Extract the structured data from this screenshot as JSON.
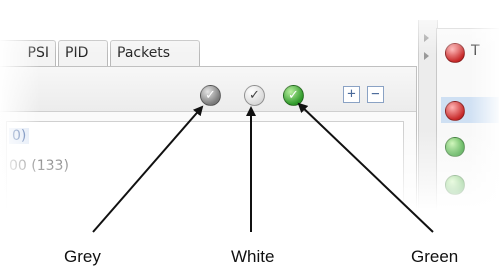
{
  "tabs": [
    {
      "label": "PSI"
    },
    {
      "label": "PID"
    },
    {
      "label": "Packets"
    }
  ],
  "list": {
    "rows": [
      "0)",
      "00 (133)"
    ]
  },
  "toolbar": {
    "status_icons": [
      {
        "icon": "grey-check-icon",
        "glyph": "✓"
      },
      {
        "icon": "white-check-icon",
        "glyph": "✓"
      },
      {
        "icon": "green-check-icon",
        "glyph": "✓"
      }
    ],
    "expand_glyph": "+",
    "collapse_glyph": "−"
  },
  "right_panel": {
    "title": "T"
  },
  "callouts": {
    "grey": "Grey",
    "white": "White",
    "green": "Green"
  },
  "colors": {
    "grey_icon": "#8a8a8a",
    "white_icon": "#e8e8e8",
    "green_icon": "#3aa63a",
    "red_icon": "#c62828",
    "selection": "#cfe0f3"
  }
}
